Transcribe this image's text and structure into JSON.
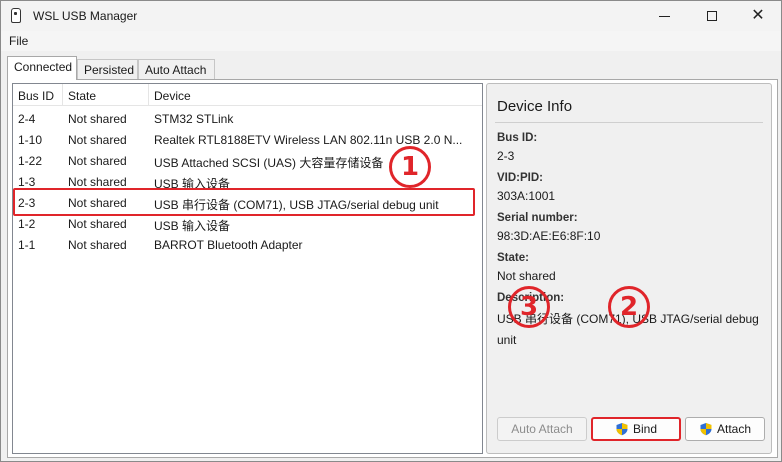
{
  "window": {
    "title": "WSL USB Manager"
  },
  "menu": {
    "file": "File"
  },
  "tabs": [
    {
      "label": "Connected",
      "active": true
    },
    {
      "label": "Persisted",
      "active": false
    },
    {
      "label": "Auto Attach",
      "active": false
    }
  ],
  "table": {
    "headers": {
      "bus_id": "Bus ID",
      "state": "State",
      "device": "Device"
    },
    "rows": [
      {
        "bus_id": "2-4",
        "state": "Not shared",
        "device": "STM32 STLink"
      },
      {
        "bus_id": "1-10",
        "state": "Not shared",
        "device": "Realtek RTL8188ETV Wireless LAN 802.11n USB 2.0 N..."
      },
      {
        "bus_id": "1-22",
        "state": "Not shared",
        "device": "USB Attached SCSI (UAS) 大容量存储设备"
      },
      {
        "bus_id": "1-3",
        "state": "Not shared",
        "device": "USB 输入设备"
      },
      {
        "bus_id": "2-3",
        "state": "Not shared",
        "device": "USB 串行设备 (COM71), USB JTAG/serial debug unit"
      },
      {
        "bus_id": "1-2",
        "state": "Not shared",
        "device": "USB 输入设备"
      },
      {
        "bus_id": "1-1",
        "state": "Not shared",
        "device": "BARROT Bluetooth Adapter"
      }
    ],
    "selected_index": 4
  },
  "device_info": {
    "title": "Device Info",
    "bus_id_label": "Bus ID:",
    "bus_id": "2-3",
    "vidpid_label": "VID:PID:",
    "vidpid": "303A:1001",
    "serial_label": "Serial number:",
    "serial": "98:3D:AE:E6:8F:10",
    "state_label": "State:",
    "state": "Not shared",
    "description_label": "Description:",
    "description": "USB 串行设备 (COM71), USB JTAG/serial debug unit"
  },
  "buttons": {
    "auto_attach": "Auto Attach",
    "bind": "Bind",
    "attach": "Attach"
  },
  "annotations": {
    "one": "1",
    "two": "2",
    "three": "3"
  },
  "colors": {
    "annotation_red": "#e0252a",
    "shield_blue": "#2f6fd6",
    "shield_yellow": "#f2c200"
  }
}
